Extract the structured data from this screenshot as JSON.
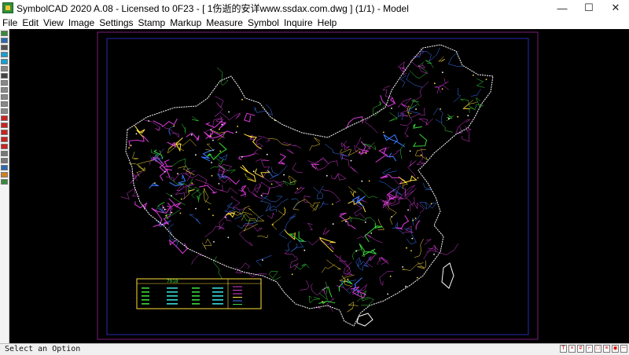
{
  "window": {
    "title": "SymbolCAD 2020 A.08 - Licensed to 0F23  -  [ 1伤逝的安详www.ssdax.com.dwg ] (1/1)  -  Model",
    "minimize_glyph": "—",
    "maximize_glyph": "☐",
    "close_glyph": "✕"
  },
  "menu": [
    "File",
    "Edit",
    "View",
    "Image",
    "Settings",
    "Stamp",
    "Markup",
    "Measure",
    "Symbol",
    "Inquire",
    "Help"
  ],
  "status": {
    "prompt": "Select an Option"
  },
  "legend": {
    "title": "7918"
  },
  "toolbar": {
    "tools": [
      {
        "icon": "open-icon",
        "color": "#3a8a3a"
      },
      {
        "icon": "save-icon",
        "color": "#2a6ab0"
      },
      {
        "icon": "print-icon",
        "color": "#555555"
      },
      {
        "icon": "refresh-icon",
        "color": "#18a0d0"
      },
      {
        "icon": "layers-icon",
        "color": "#18a0d0"
      },
      {
        "icon": "print-preview-icon",
        "color": "#888888"
      },
      {
        "icon": "binoculars-icon",
        "color": "#444444"
      },
      {
        "icon": "zoom-in-icon",
        "color": "#888888"
      },
      {
        "icon": "zoom-out-icon",
        "color": "#888888"
      },
      {
        "icon": "zoom-window-icon",
        "color": "#888888"
      },
      {
        "icon": "zoom-extents-icon",
        "color": "#888888"
      },
      {
        "icon": "pan-icon",
        "color": "#888888"
      },
      {
        "icon": "redline-icon",
        "color": "#cc2222"
      },
      {
        "icon": "pen-icon",
        "color": "#cc2222"
      },
      {
        "icon": "text-icon",
        "color": "#cc2222"
      },
      {
        "icon": "highlight-icon",
        "color": "#cc2222"
      },
      {
        "icon": "measure-icon",
        "color": "#cc2222"
      },
      {
        "icon": "stamp-icon",
        "color": "#777777"
      },
      {
        "icon": "symbol-icon",
        "color": "#777777"
      },
      {
        "icon": "info-icon",
        "color": "#2a6ab0"
      },
      {
        "icon": "palette-icon",
        "color": "#d08020"
      },
      {
        "icon": "help-icon",
        "color": "#3a8a3a"
      }
    ]
  },
  "status_icons": [
    {
      "icon": "text-toggle-icon",
      "glyph": "T"
    },
    {
      "icon": "snap-icon",
      "glyph": "×"
    },
    {
      "icon": "grid-icon",
      "glyph": "#"
    },
    {
      "icon": "ortho-icon",
      "glyph": "⌐"
    },
    {
      "icon": "osnap-icon",
      "glyph": "□"
    },
    {
      "icon": "layer-icon",
      "glyph": "≡"
    },
    {
      "icon": "color-icon",
      "glyph": "◉"
    },
    {
      "icon": "lineweight-icon",
      "glyph": "─"
    }
  ],
  "colors": {
    "drawing_background": "#000000",
    "frame_outer": "#7a1c7a",
    "frame_inner": "#2a2ab0",
    "road_primary": "#d93bd9",
    "road_secondary": "#ffe03a",
    "road_tertiary": "#3a7bff",
    "road_quaternary": "#3ad93a",
    "border": "#ffffff"
  }
}
